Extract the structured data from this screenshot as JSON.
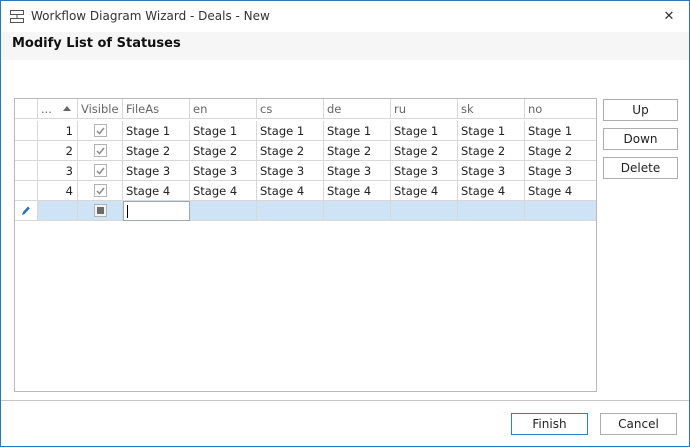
{
  "window": {
    "title": "Workflow Diagram Wizard - Deals - New",
    "close_glyph": "✕"
  },
  "heading": "Modify List of Statuses",
  "grid": {
    "columns": [
      "...",
      "Visible",
      "FileAs",
      "en",
      "cs",
      "de",
      "ru",
      "sk",
      "no"
    ],
    "sorted_column": "...",
    "rows": [
      {
        "num": "1",
        "visible": true,
        "values": [
          "Stage 1",
          "Stage 1",
          "Stage 1",
          "Stage 1",
          "Stage 1",
          "Stage 1",
          "Stage 1"
        ]
      },
      {
        "num": "2",
        "visible": true,
        "values": [
          "Stage 2",
          "Stage 2",
          "Stage 2",
          "Stage 2",
          "Stage 2",
          "Stage 2",
          "Stage 2"
        ]
      },
      {
        "num": "3",
        "visible": true,
        "values": [
          "Stage 3",
          "Stage 3",
          "Stage 3",
          "Stage 3",
          "Stage 3",
          "Stage 3",
          "Stage 3"
        ]
      },
      {
        "num": "4",
        "visible": true,
        "values": [
          "Stage 4",
          "Stage 4",
          "Stage 4",
          "Stage 4",
          "Stage 4",
          "Stage 4",
          "Stage 4"
        ]
      }
    ],
    "new_row": {
      "visible_state": "indeterminate",
      "editing_value": ""
    }
  },
  "side_buttons": {
    "up": "Up",
    "down": "Down",
    "delete": "Delete"
  },
  "footer": {
    "finish": "Finish",
    "cancel": "Cancel"
  },
  "icons": {
    "app": "workflow-icon",
    "close": "close-icon",
    "sort": "sort-ascending-icon",
    "check": "checkmark-icon",
    "edit_row": "pencil-icon"
  },
  "colors": {
    "accent": "#2b78c2",
    "selection": "#cfe3f6",
    "primary_button_border": "#2d7fd0"
  }
}
